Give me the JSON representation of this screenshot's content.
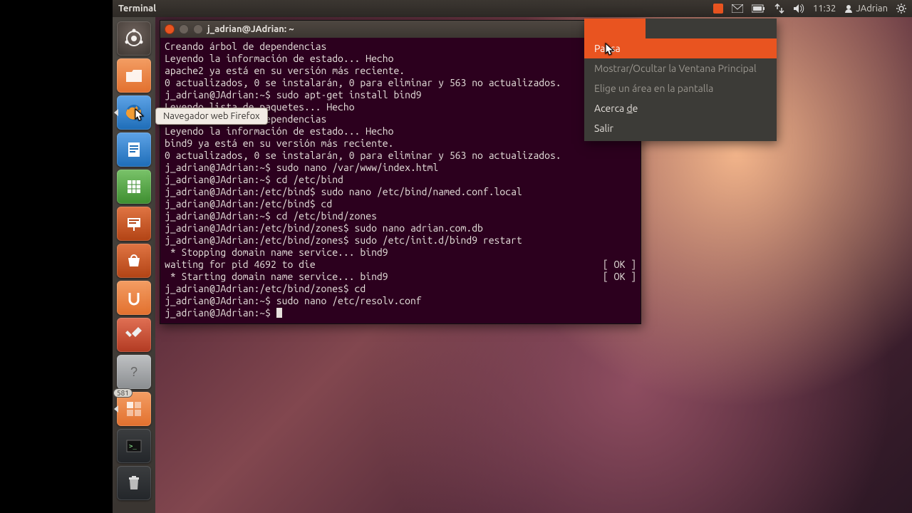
{
  "panel": {
    "app_title": "Terminal",
    "time": "11:32",
    "user": "JAdrian"
  },
  "launcher": {
    "tooltip_firefox": "Navegador web Firefox",
    "trash_badge": "581"
  },
  "menu": {
    "items": [
      {
        "label": "Pausa",
        "hi": true
      },
      {
        "label": "Mostrar/Ocultar la Ventana Principal",
        "dim": true
      },
      {
        "label": "Elige un área en la pantalla",
        "dim": true
      },
      {
        "label_html": "Acerca <u>d</u>e"
      },
      {
        "label": "Salir"
      }
    ]
  },
  "terminal": {
    "title": "j_adrian@JAdrian: ~",
    "lines": [
      "Creando árbol de dependencias",
      "Leyendo la información de estado... Hecho",
      "apache2 ya está en su versión más reciente.",
      "0 actualizados, 0 se instalarán, 0 para eliminar y 563 no actualizados.",
      "j_adrian@JAdrian:~$ sudo apt-get install bind9",
      "Leyendo lista de paquetes... Hecho",
      "Creando árbol de dependencias",
      "Leyendo la información de estado... Hecho",
      "bind9 ya está en su versión más reciente.",
      "0 actualizados, 0 se instalarán, 0 para eliminar y 563 no actualizados.",
      "j_adrian@JAdrian:~$ sudo nano /var/www/index.html",
      "j_adrian@JAdrian:~$ cd /etc/bind",
      "j_adrian@JAdrian:/etc/bind$ sudo nano /etc/bind/named.conf.local",
      "j_adrian@JAdrian:/etc/bind$ cd",
      "j_adrian@JAdrian:~$ cd /etc/bind/zones",
      "j_adrian@JAdrian:/etc/bind/zones$ sudo nano adrian.com.db",
      "j_adrian@JAdrian:/etc/bind/zones$ sudo /etc/init.d/bind9 restart",
      " * Stopping domain name service... bind9"
    ],
    "wait_line": "waiting for pid 4692 to die",
    "ok_tag": "[ OK ]",
    "start_line": " * Starting domain name service... bind9",
    "lines_after": [
      "j_adrian@JAdrian:/etc/bind/zones$ cd",
      "j_adrian@JAdrian:~$ sudo nano /etc/resolv.conf"
    ],
    "prompt": "j_adrian@JAdrian:~$ "
  }
}
